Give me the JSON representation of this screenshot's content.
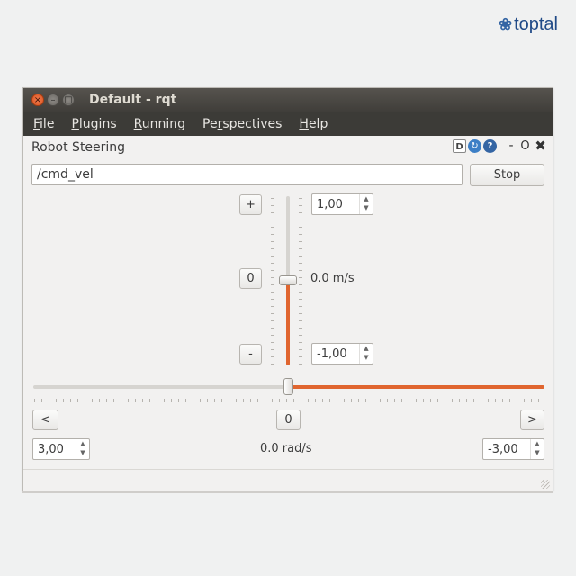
{
  "brand": {
    "logo_text": "toptal",
    "icon": "toptal-logo-icon"
  },
  "window": {
    "title": "Default - rqt",
    "controls": {
      "close": "×",
      "minimize": "–",
      "maximize": "□"
    }
  },
  "menubar": {
    "items": [
      {
        "label": "File",
        "accel": "F",
        "rest": "ile"
      },
      {
        "label": "Plugins",
        "accel": "P",
        "rest": "lugins"
      },
      {
        "label": "Running",
        "accel": "R",
        "rest": "unning"
      },
      {
        "label": "Perspectives",
        "pre": "Pe",
        "accel": "r",
        "rest": "spectives"
      },
      {
        "label": "Help",
        "accel": "H",
        "rest": "elp"
      }
    ]
  },
  "plugin": {
    "title": "Robot Steering",
    "icons": {
      "d": "D",
      "reload": "↻",
      "help": "?",
      "minimize": "-",
      "restore": "O",
      "close": "✖"
    }
  },
  "topic": {
    "value": "/cmd_vel"
  },
  "stop_button": {
    "label": "Stop"
  },
  "linear": {
    "increase_label": "+",
    "zero_label": "0",
    "decrease_label": "-",
    "max_value": "1,00",
    "min_value": "-1,00",
    "current": "0.0 m/s",
    "slider_fraction": 0.5
  },
  "angular": {
    "left_label": "<",
    "zero_label": "0",
    "right_label": ">",
    "max_value": "3,00",
    "min_value": "-3,00",
    "current": "0.0 rad/s",
    "slider_fraction": 0.5
  },
  "spin_arrows": {
    "up": "▲",
    "down": "▼"
  },
  "colors": {
    "accent": "#e0652f",
    "titlebar": "#3c3b37",
    "brand": "#204a87"
  }
}
